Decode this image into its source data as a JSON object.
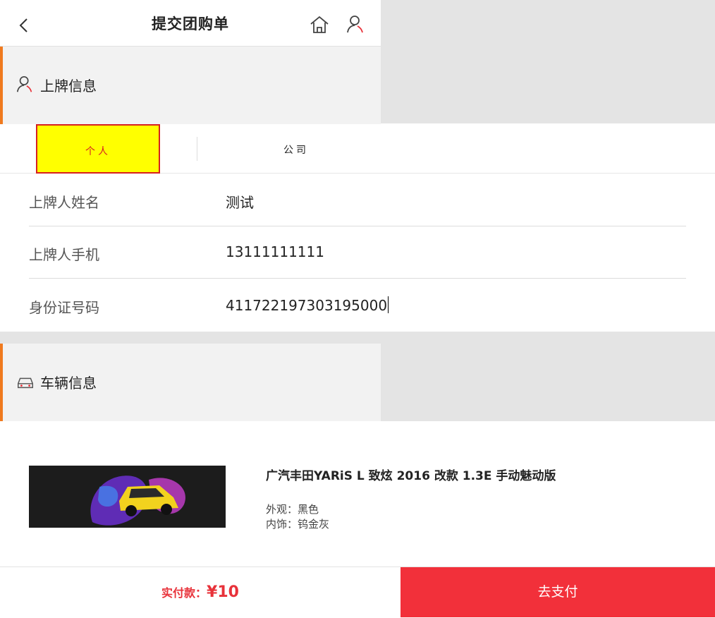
{
  "header": {
    "title": "提交团购单",
    "back_icon": "chevron-left-icon",
    "home_icon": "home-icon",
    "user_icon": "user-icon"
  },
  "plate_section": {
    "title": "上牌信息",
    "icon": "user-icon",
    "tabs": [
      {
        "label": "个人",
        "selected": true
      },
      {
        "label": "公司",
        "selected": false
      }
    ],
    "fields": [
      {
        "label": "上牌人姓名",
        "value": "测试"
      },
      {
        "label": "上牌人手机",
        "value": "13111111111"
      },
      {
        "label": "身份证号码",
        "value": "411722197303195000"
      }
    ]
  },
  "vehicle_section": {
    "title": "车辆信息",
    "icon": "car-icon",
    "car": {
      "name": "广汽丰田YARiS L 致炫 2016 改款 1.3E 手动魅动版",
      "exterior": "外观：黑色",
      "interior": "内饰：钨金灰"
    }
  },
  "footer": {
    "total_label": "实付款：",
    "total_amount": "¥10",
    "pay_label": "去支付"
  },
  "colors": {
    "accent": "#f07a1e",
    "pay_button": "#f2303a",
    "price": "#e8323a",
    "selected_tab_bg": "#ffff00"
  }
}
